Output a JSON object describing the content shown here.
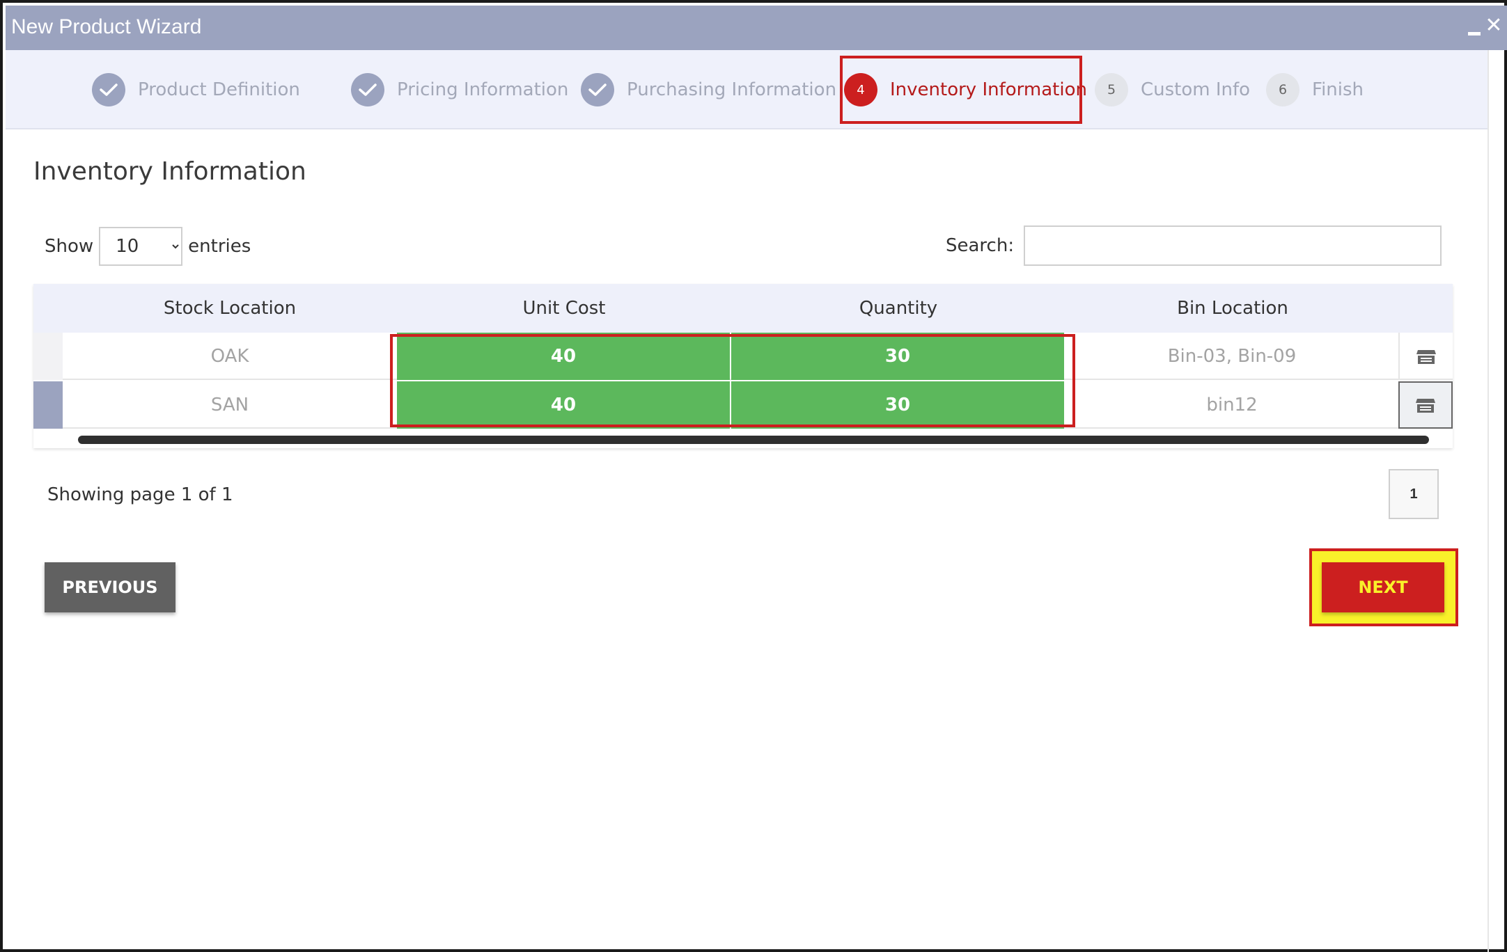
{
  "window": {
    "title": "New Product Wizard"
  },
  "steps": [
    {
      "label": "Product Definition",
      "state": "done",
      "number": ""
    },
    {
      "label": "Pricing Information",
      "state": "done",
      "number": ""
    },
    {
      "label": "Purchasing Information",
      "state": "done",
      "number": ""
    },
    {
      "label": "Inventory Information",
      "state": "current",
      "number": "4"
    },
    {
      "label": "Custom Info",
      "state": "todo",
      "number": "5"
    },
    {
      "label": "Finish",
      "state": "todo",
      "number": "6"
    }
  ],
  "section": {
    "title": "Inventory Information"
  },
  "table_controls": {
    "show_label": "Show",
    "entries_label": "entries",
    "page_size": "10",
    "search_label": "Search:",
    "search_value": ""
  },
  "table": {
    "headers": [
      "Stock Location",
      "Unit Cost",
      "Quantity",
      "Bin Location"
    ],
    "rows": [
      {
        "stock_location": "OAK",
        "unit_cost": "40",
        "quantity": "30",
        "bin_location": "Bin-03, Bin-09"
      },
      {
        "stock_location": "SAN",
        "unit_cost": "40",
        "quantity": "30",
        "bin_location": "bin12"
      }
    ]
  },
  "pagination": {
    "status": "Showing page 1 of 1",
    "current_page": "1"
  },
  "buttons": {
    "previous": "PREVIOUS",
    "next": "NEXT"
  },
  "colors": {
    "titlebar": "#9ba3bf",
    "accent_red": "#cc1f1f",
    "cell_green": "#5cb85c",
    "next_highlight": "#f9f12a",
    "previous_button": "#616161"
  },
  "icons": {
    "step_done": "check-icon",
    "row_action": "warehouse-icon",
    "window_min": "minimize-icon",
    "window_close": "close-icon"
  }
}
